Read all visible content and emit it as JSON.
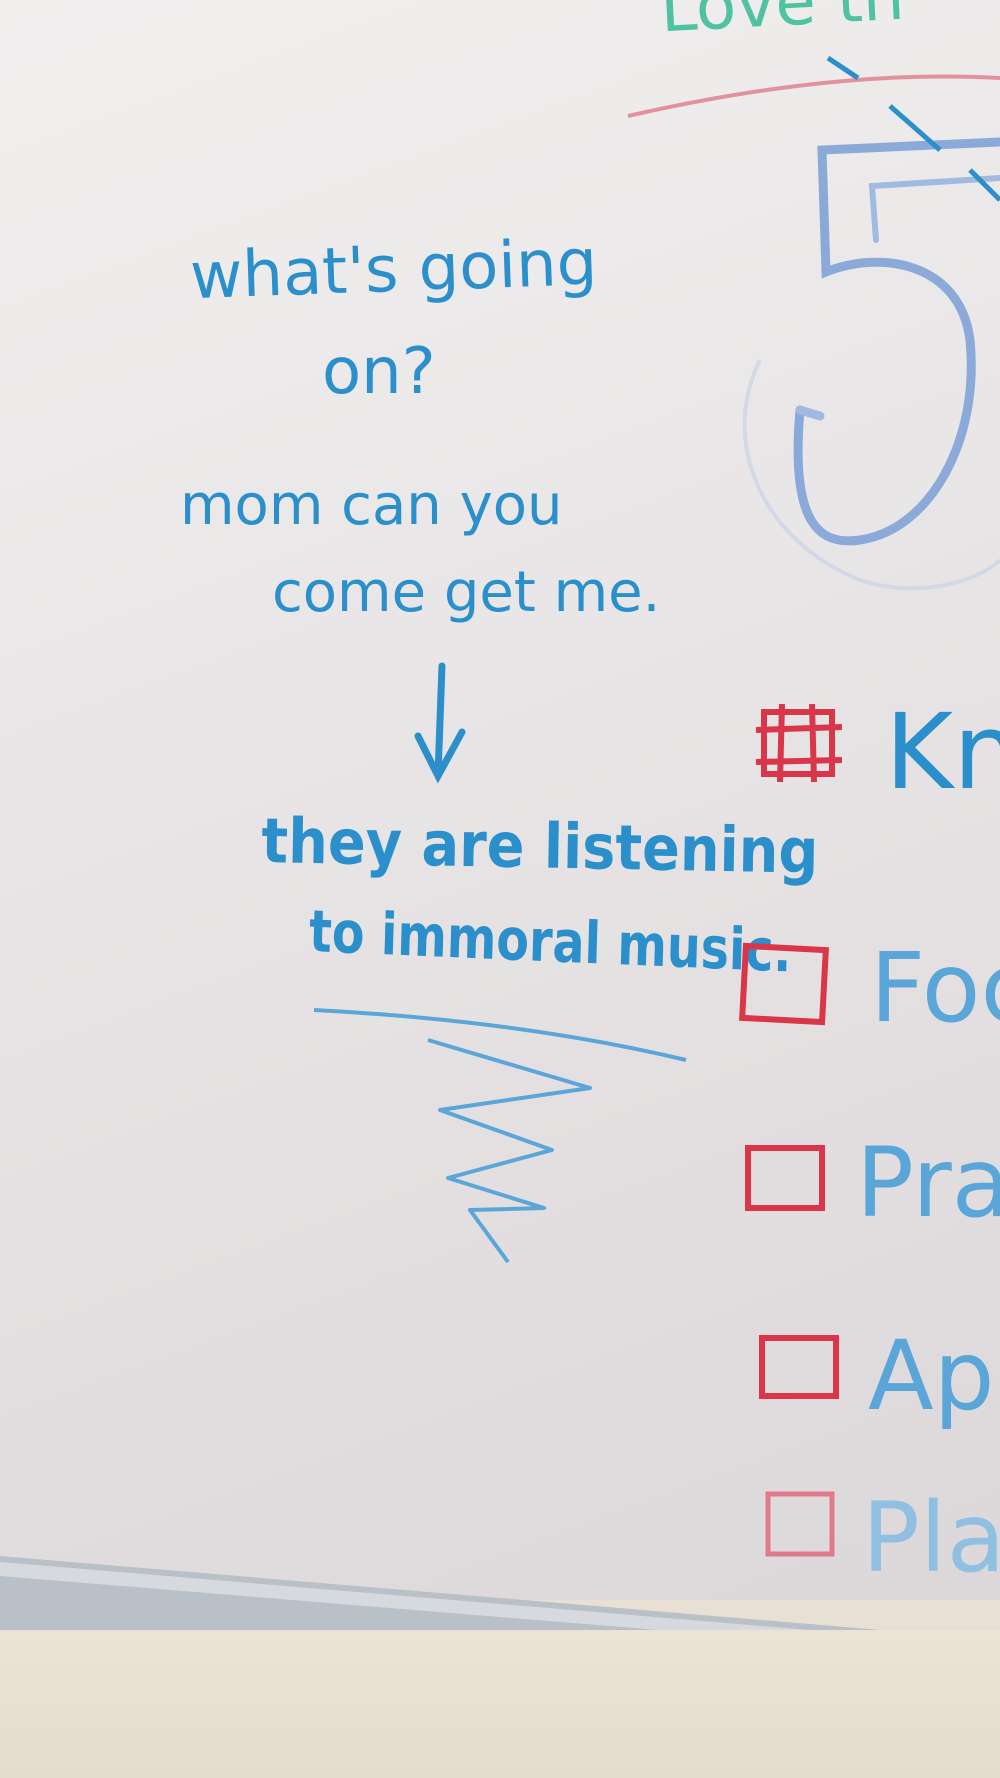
{
  "note": {
    "line1": "what's going",
    "line2": "on?",
    "line3": "mom can you",
    "line4": "come get me.",
    "line5": "they are listening",
    "line6": "to immoral music."
  },
  "board_right": {
    "top_partial": "Love th",
    "big_number": "5",
    "checklist": [
      {
        "text": "Kn",
        "checked": true
      },
      {
        "text": "Foc",
        "checked": false
      },
      {
        "text": "Prac",
        "checked": false
      },
      {
        "text": "Ap",
        "checked": false
      },
      {
        "text": "Plan",
        "checked": false
      }
    ]
  },
  "colors": {
    "marker_blue": "#2b8fcb",
    "marker_red": "#d9364a",
    "marker_teal": "#4fc3a1",
    "board_white": "#eeebea",
    "tray_gray": "#b8bec4"
  }
}
